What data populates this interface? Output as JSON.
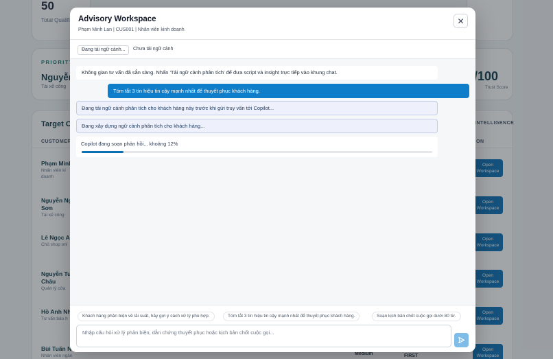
{
  "background": {
    "kpi": {
      "value": "50",
      "label": "Total Qualifi"
    },
    "priority": {
      "label": "PRIORITY",
      "name": "Nguyễn",
      "sub": "Tài xế công"
    },
    "trust": {
      "score": "7/100",
      "label": "Trust Score"
    },
    "section_title": "Target Cu",
    "columns": {
      "customer": "CUSTOMER",
      "intelligence": "INTELLIGENCE",
      "action": "ON"
    },
    "customers": [
      {
        "name": "Phạm Minh",
        "sub1": "Nhân viên ki",
        "sub2": "doanh"
      },
      {
        "name": "Nguyễn Ng",
        "name2": "Sơn",
        "sub1": "Tài xế công"
      },
      {
        "name": "Lê Ngọc An",
        "sub1": "Chủ shop onl"
      },
      {
        "name": "Nguyễn Tua",
        "name2": "Châu",
        "sub1": "Quản lý cửa"
      },
      {
        "name": "Hồ Anh Nh",
        "sub1": "Tư vấn bảo h"
      },
      {
        "name": "Bùi Tuấn N",
        "sub1": "Nhân viên ngân"
      }
    ],
    "open_label_1": "Open",
    "open_label_2": "Workspace",
    "bottom": {
      "medium": "Medium",
      "first": "FIRST"
    }
  },
  "modal": {
    "title": "Advisory Workspace",
    "subtitle": "Phạm Minh Lan | CUS001 | Nhân viên kinh doanh",
    "status_chips": [
      "Đang tải ngữ cảnh...",
      "Chưa tải ngữ cảnh"
    ],
    "close_label": "✕",
    "messages": {
      "system": "Không gian tư vấn đã sẵn sàng. Nhấn 'Tải ngữ cảnh phân tích' để đưa script và insight trực tiếp vào khung chat.",
      "user": "Tóm tắt 3 tín hiệu tin cậy mạnh nhất để thuyết phục khách hàng.",
      "status_1": "Đang tải ngữ cảnh phân tích cho khách hàng này trước khi gửi truy vấn tới Copilot...",
      "status_2": "Đang xây dựng ngữ cảnh phân tích cho khách hàng...",
      "progress_text": "Copilot đang soạn phản hồi... khoảng 12%",
      "progress": 0.12
    },
    "suggestions": [
      "Khách hàng phản biện về lãi suất, hãy gợi ý cách xử lý phù hợp.",
      "Tóm tắt 3 tín hiệu tin cậy mạnh nhất để thuyết phục khách hàng.",
      "Soạn kịch bản chốt cuộc gọi dưới 80 từ."
    ],
    "composer_placeholder": "Nhập câu hỏi xử lý phản biện, dẫn chứng thuyết phục hoặc kịch bản chốt cuộc gọi...",
    "send_icon": "send-icon",
    "colors": {
      "primary": "#0e7ecb",
      "send_disabled": "#7fbde8",
      "status_bg": "#eef1fb"
    }
  }
}
